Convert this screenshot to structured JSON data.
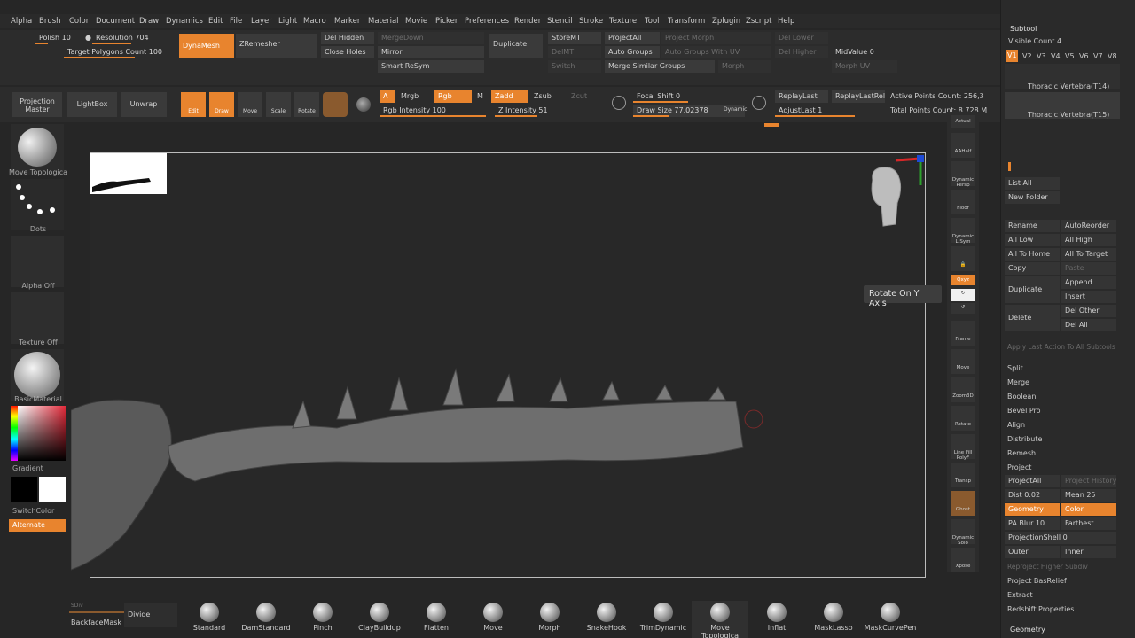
{
  "menu": [
    "Alpha",
    "Brush",
    "Color",
    "Document",
    "Draw",
    "Dynamics",
    "Edit",
    "File",
    "Layer",
    "Light",
    "Macro",
    "Marker",
    "Material",
    "Movie",
    "Picker",
    "Preferences",
    "Render",
    "Stencil",
    "Stroke",
    "Texture",
    "Tool",
    "Transform",
    "Zplugin",
    "Zscript",
    "Help"
  ],
  "toprow": {
    "polish": "Polish 10",
    "resolution": "Resolution 704",
    "target_polygons": "Target Polygons Count 100",
    "dynamesh": "DynaMesh",
    "zremesher": "ZRemesher",
    "del_hidden": "Del Hidden",
    "close_holes": "Close Holes",
    "merge_down": "MergeDown",
    "mirror": "Mirror",
    "smart_resym": "Smart ReSym",
    "duplicate": "Duplicate",
    "store_mt": "StoreMT",
    "del_mt": "DelMT",
    "switch": "Switch",
    "project_all": "ProjectAll",
    "auto_groups": "Auto Groups",
    "merge_similar": "Merge Similar Groups",
    "project_morph": "Project Morph",
    "auto_groups_uv": "Auto Groups With UV",
    "morph": "Morph",
    "del_lower": "Del Lower",
    "del_higher": "Del Higher",
    "mid_value": "MidValue 0",
    "morph_uv": "Morph UV"
  },
  "toolrow": {
    "projection_master": "Projection Master",
    "lightbox": "LightBox",
    "unwrap": "Unwrap",
    "edit": "Edit",
    "draw": "Draw",
    "move": "Move",
    "scale": "Scale",
    "rotate": "Rotate",
    "a": "A",
    "mrgb": "Mrgb",
    "rgb": "Rgb",
    "m": "M",
    "zadd": "Zadd",
    "zsub": "Zsub",
    "zcut": "Zcut",
    "rgb_intensity": "Rgb Intensity 100",
    "z_intensity": "Z Intensity 51",
    "focal_shift": "Focal Shift 0",
    "draw_size": "Draw Size 77.02378",
    "dynamic": "Dynamic",
    "replay_last": "ReplayLast",
    "replay_last_rel": "ReplayLastRel",
    "adjust_last": "AdjustLast 1",
    "active_points": "Active Points Count: 256,3",
    "total_points": "Total Points Count: 8.728 M"
  },
  "leftshelf": {
    "move_topological": "Move Topologica",
    "dots": "Dots",
    "alpha_off": "Alpha Off",
    "texture_off": "Texture Off",
    "basic_material": "BasicMaterial",
    "gradient": "Gradient",
    "switch_color": "SwitchColor",
    "alternate": "Alternate"
  },
  "rightshelf": [
    "Actual",
    "AAHalf",
    "Dynamic Persp",
    "Floor",
    "Dynamic L.Sym",
    "",
    "Qxyz",
    "",
    "",
    "Frame",
    "Move",
    "Zoom3D",
    "Rotate",
    "Line Fill PolyF",
    "Transp",
    "Ghost",
    "Dynamic Solo",
    "Xpose"
  ],
  "tooltip": "Rotate On Y Axis",
  "tray": {
    "subtool": "Subtool",
    "visible_count": "Visible Count 4",
    "versions": [
      "V1",
      "V2",
      "V3",
      "V4",
      "V5",
      "V6",
      "V7",
      "V8"
    ],
    "items": [
      "Thoracic Vertebra(T14)",
      "Thoracic Vertebra(T15)"
    ],
    "list_all": "List All",
    "new_folder": "New Folder",
    "rename": "Rename",
    "auto_reorder": "AutoReorder",
    "all_low": "All Low",
    "all_high": "All High",
    "all_to_home": "All To Home",
    "all_to_target": "All To Target",
    "copy": "Copy",
    "paste": "Paste",
    "duplicate": "Duplicate",
    "append": "Append",
    "insert": "Insert",
    "delete": "Delete",
    "del_other": "Del Other",
    "del_all": "Del All",
    "apply_last": "Apply Last Action To All Subtools",
    "split": "Split",
    "merge": "Merge",
    "boolean": "Boolean",
    "bevel_pro": "Bevel Pro",
    "align": "Align",
    "distribute": "Distribute",
    "remesh": "Remesh",
    "project": "Project",
    "project_all": "ProjectAll",
    "project_history": "Project History",
    "dist": "Dist 0.02",
    "mean": "Mean 25",
    "geometry": "Geometry",
    "color": "Color",
    "pa_blur": "PA Blur 10",
    "farthest": "Farthest",
    "projection_shell": "ProjectionShell 0",
    "outer": "Outer",
    "inner": "Inner",
    "reproject": "Reproject Higher Subdiv",
    "project_basrelief": "Project BasRelief",
    "extract": "Extract",
    "redshift": "Redshift Properties",
    "geometry_footer": "Geometry"
  },
  "bottom": {
    "sdiv": "SDiv",
    "divide": "Divide",
    "backface_mask": "BackfaceMask",
    "brushes": [
      "Standard",
      "DamStandard",
      "Pinch",
      "ClayBuildup",
      "Flatten",
      "Move",
      "Morph",
      "SnakeHook",
      "TrimDynamic",
      "Move Topologica",
      "Inflat",
      "MaskLasso",
      "MaskCurvePen"
    ]
  },
  "colors": {
    "accent": "#e8842e",
    "background": "#262626",
    "panel": "#2c2c2c"
  }
}
